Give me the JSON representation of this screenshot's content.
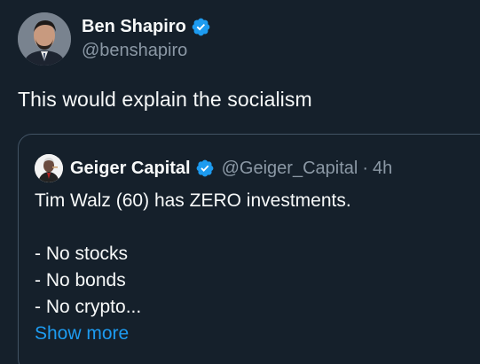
{
  "tweet": {
    "author": {
      "display_name": "Ben Shapiro",
      "handle": "@benshapiro",
      "verified": true,
      "avatar_icon": "person-avatar-icon"
    },
    "text": "This would explain the socialism"
  },
  "quote": {
    "author": {
      "display_name": "Geiger Capital",
      "handle": "@Geiger_Capital",
      "verified": true,
      "avatar_icon": "person-avatar-icon"
    },
    "separator": "·",
    "time": "4h",
    "lines": [
      "Tim Walz (60) has ZERO investments.",
      "",
      "- No stocks",
      "- No bonds",
      "- No crypto..."
    ],
    "show_more_label": "Show more"
  },
  "colors": {
    "background": "#15202b",
    "text_primary": "#f7f9f9",
    "text_secondary": "#8b98a5",
    "accent": "#1d9bf0",
    "border": "#425364"
  }
}
